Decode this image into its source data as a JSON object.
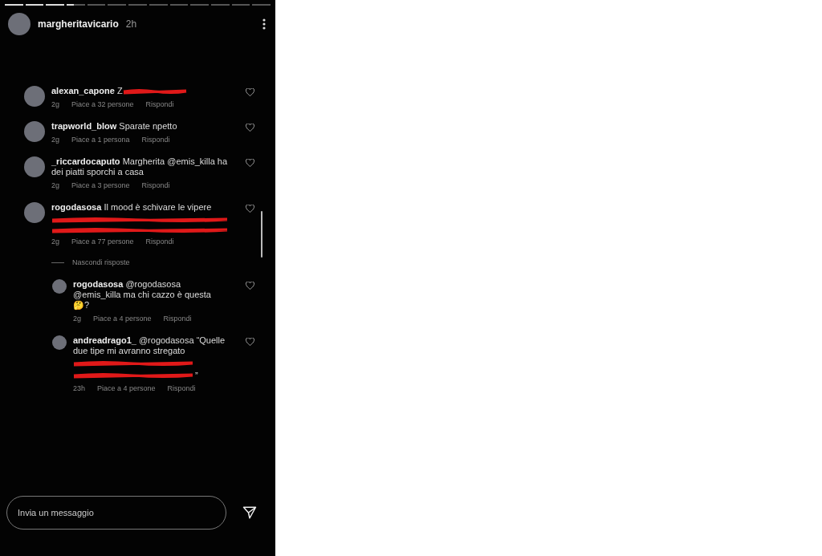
{
  "story": {
    "segments": [
      {
        "level": 1
      },
      {
        "level": 1
      },
      {
        "level": 1
      },
      {
        "level": 0.4
      },
      {
        "level": 0
      },
      {
        "level": 0
      },
      {
        "level": 0
      },
      {
        "level": 0
      },
      {
        "level": 0
      },
      {
        "level": 0
      },
      {
        "level": 0
      },
      {
        "level": 0
      },
      {
        "level": 0
      }
    ],
    "username": "margheritavicario",
    "time": "2h"
  },
  "comments": [
    {
      "user": "alexan_capone",
      "text": "Z",
      "redactions": [
        {
          "kind": "inline"
        }
      ],
      "age": "2g",
      "likes": "Piace a 32 persone",
      "reply": "Rispondi"
    },
    {
      "user": "trapworld_blow",
      "text": "Sparate npetto",
      "age": "2g",
      "likes": "Piace a 1 persona",
      "reply": "Rispondi"
    },
    {
      "user": "_riccardocaputo",
      "text": "Margherita @emis_killa ha dei piatti sporchi a casa",
      "age": "2g",
      "likes": "Piace a 3 persone",
      "reply": "Rispondi"
    },
    {
      "user": "rogodasosa",
      "text": "Il mood è schivare le vipere",
      "redactions": [
        {
          "kind": "line"
        },
        {
          "kind": "line"
        }
      ],
      "age": "2g",
      "likes": "Piace a 77 persone",
      "reply": "Rispondi",
      "hide_replies": "Nascondi risposte",
      "replies": [
        {
          "user": "rogodasosa",
          "text": "@rogodasosa @emis_killa ma chi cazzo è questa 🤔?",
          "age": "2g",
          "likes": "Piace a 4 persone",
          "reply": "Rispondi"
        },
        {
          "user": "andreadrago1_",
          "text": "@rogodasosa “Quelle due tipe mi avranno stregato",
          "redactions": [
            {
              "kind": "line"
            },
            {
              "kind": "line",
              "trailing": "”"
            }
          ],
          "age": "23h",
          "likes": "Piace a 4 persone",
          "reply": "Rispondi"
        }
      ]
    }
  ],
  "composer": {
    "placeholder": "Invia un messaggio"
  }
}
